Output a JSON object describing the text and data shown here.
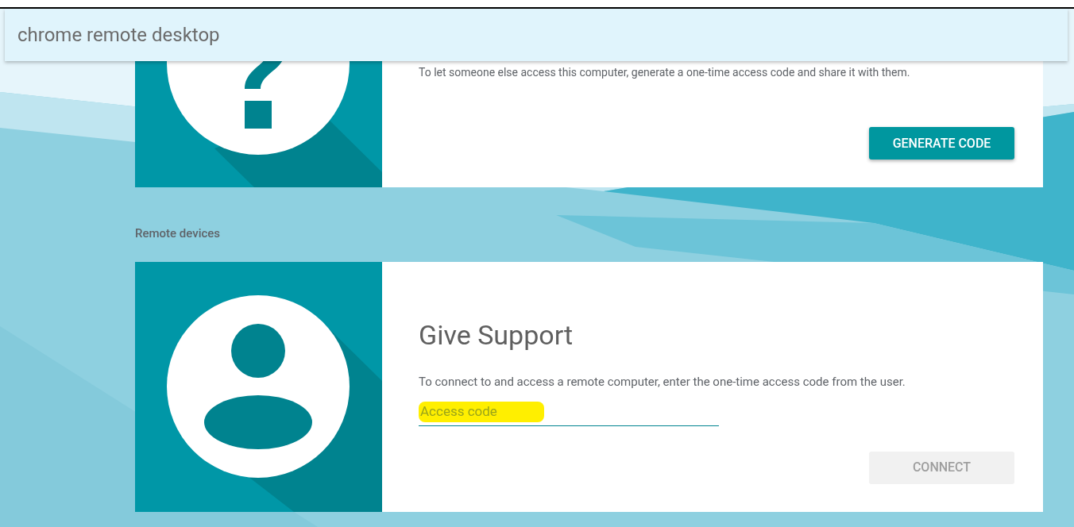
{
  "app_title": "chrome remote desktop",
  "share_card": {
    "description": "To let someone else access this computer, generate a one-time access code and share it with them.",
    "button": {
      "label": "GENERATE CODE",
      "disabled": false
    }
  },
  "section_label": "Remote devices",
  "support_card": {
    "title": "Give Support",
    "description": "To connect to and access a remote computer, enter the one-time access code from the user.",
    "access_code": {
      "placeholder": "Access code",
      "highlighted": true
    },
    "button": {
      "label": "CONNECT",
      "disabled": true
    }
  }
}
